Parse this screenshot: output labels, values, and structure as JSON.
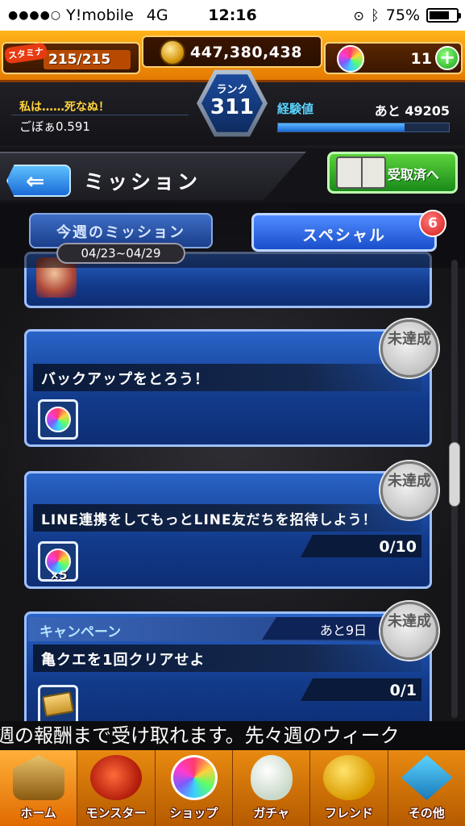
{
  "status_bar": {
    "carrier": "Y!mobile",
    "network": "4G",
    "time": "12:16",
    "battery": "75%"
  },
  "hud": {
    "stamina_label": "スタミナ",
    "stamina": "215/215",
    "coins": "447,380,438",
    "orbs": "11",
    "plus_label": "+",
    "rank_label": "ランク",
    "rank": "311",
    "user_title": "私は……死なぬ！",
    "user_name": "ごぼぁ0.591",
    "exp_label": "経験値",
    "exp_remaining": "あと 49205",
    "exp_fill_fraction": 0.74
  },
  "header": {
    "back_arrow": "⇐",
    "title": "ミッション",
    "received_button": "受取済へ"
  },
  "tabs": {
    "weekly": "今週のミッション",
    "date_range": "04/23~04/29",
    "special": "スペシャル",
    "special_badge": "6"
  },
  "missions": [
    {
      "title": "バックアップをとろう！",
      "status": "未達成",
      "reward_icon": "rainbow-orb-icon"
    },
    {
      "title": "LINE連携をしてもっとLINE友だちを招待しよう！",
      "status": "未達成",
      "reward_icon": "rainbow-orb-icon",
      "reward_qty": "×5",
      "progress": "0/10"
    },
    {
      "category": "キャンペーン",
      "remaining": "あと9日",
      "title": "亀クエを1回クリアせよ",
      "status": "未達成",
      "reward_icon": "ticket-icon",
      "progress": "0/1"
    }
  ],
  "ticker": "週の報酬まで受け取れます。先々週のウィーク",
  "bottom_nav": [
    {
      "label": "ホーム",
      "icon": "home-icon"
    },
    {
      "label": "モンスター",
      "icon": "monster-icon"
    },
    {
      "label": "ショップ",
      "icon": "orb-shop-icon"
    },
    {
      "label": "ガチャ",
      "icon": "gacha-egg-icon"
    },
    {
      "label": "フレンド",
      "icon": "friend-icon"
    },
    {
      "label": "その他",
      "icon": "other-icon"
    }
  ],
  "colors": {
    "accent_orange": "#f29a10",
    "card_blue": "#1a4ea8",
    "exp_blue": "#1a6ad6"
  }
}
